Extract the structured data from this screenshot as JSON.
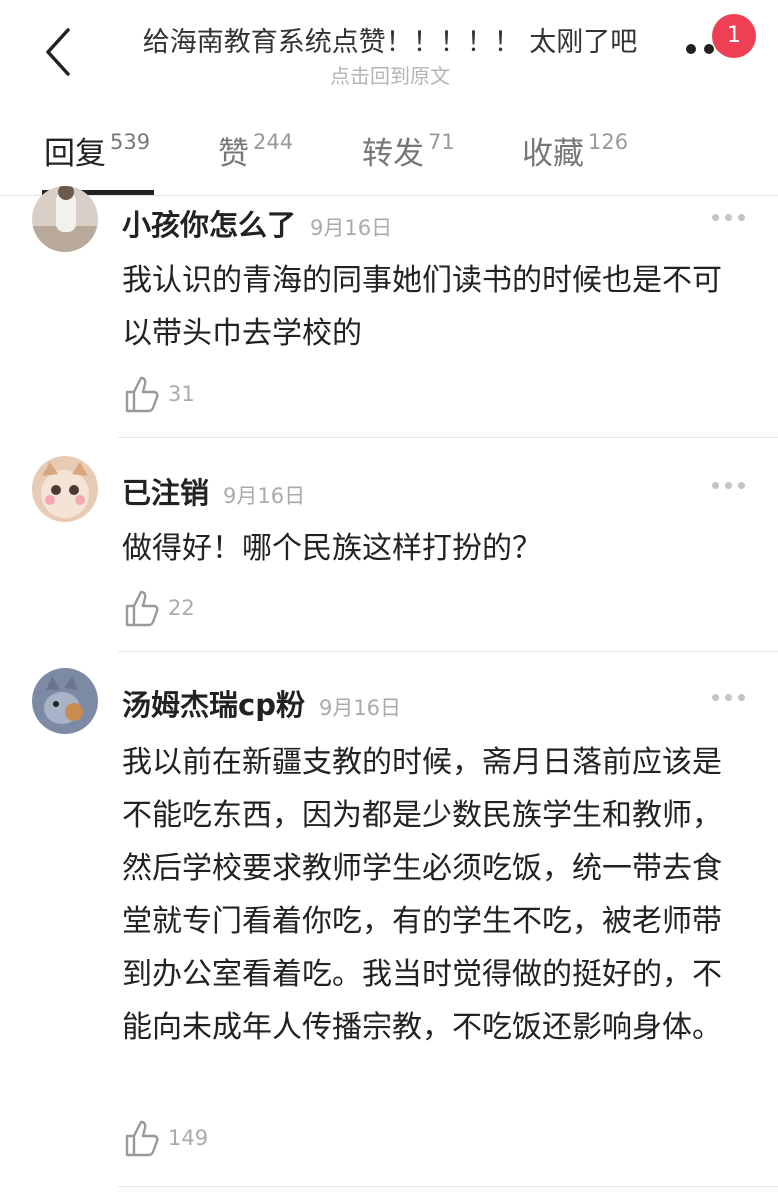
{
  "header": {
    "title": "给海南教育系统点赞！！！！！ 太刚了吧",
    "subtitle": "点击回到原文",
    "notification_count": "1"
  },
  "tabs": [
    {
      "label": "回复",
      "count": "539",
      "active": true
    },
    {
      "label": "赞",
      "count": "244",
      "active": false
    },
    {
      "label": "转发",
      "count": "71",
      "active": false
    },
    {
      "label": "收藏",
      "count": "126",
      "active": false
    }
  ],
  "comments": [
    {
      "name": "小孩你怎么了",
      "date": "9月16日",
      "text": "我认识的青海的同事她们读书的时候也是不可以带头巾去学校的",
      "likes": "31"
    },
    {
      "name": "已注销",
      "date": "9月16日",
      "text": "做得好！哪个民族这样打扮的？",
      "likes": "22"
    },
    {
      "name": "汤姆杰瑞cp粉",
      "date": "9月16日",
      "text": "我以前在新疆支教的时候，斋月日落前应该是不能吃东西，因为都是少数民族学生和教师，然后学校要求教师学生必须吃饭，统一带去食堂就专门看着你吃，有的学生不吃，被老师带到办公室看着吃。我当时觉得做的挺好的，不能向未成年人传播宗教，不吃饭还影响身体。",
      "likes": "149"
    }
  ],
  "colors": {
    "badge": "#ef3f54",
    "text_primary": "#222222",
    "text_secondary": "#aaaaaa"
  },
  "icons": [
    "back-arrow-icon",
    "more-dots-icon",
    "thumbs-up-icon"
  ]
}
